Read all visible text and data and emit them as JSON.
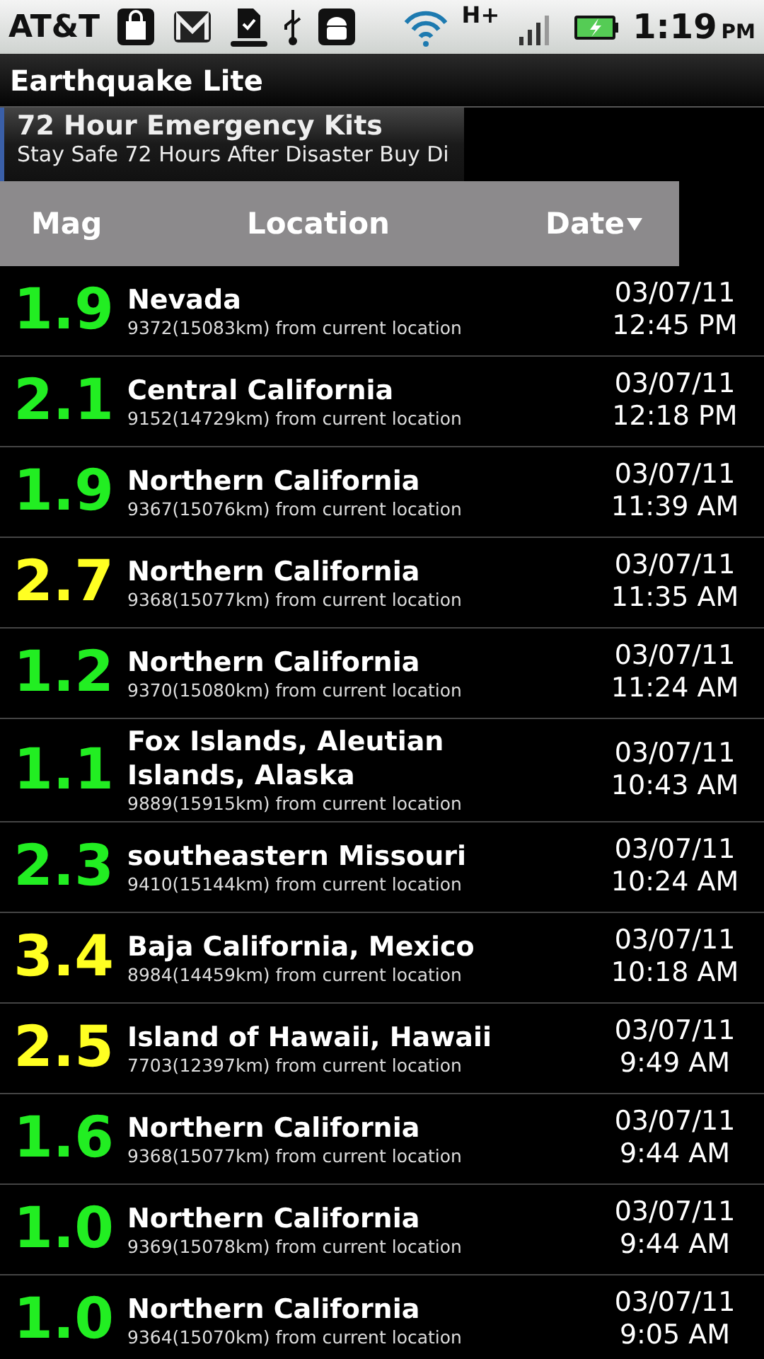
{
  "status_bar": {
    "carrier": "AT&T",
    "network": "H+",
    "time": "1:19",
    "period": "PM"
  },
  "app_title": "Earthquake Lite",
  "ad": {
    "title": "72 Hour Emergency Kits",
    "text": "Stay Safe 72 Hours After Disaster Buy Di"
  },
  "table": {
    "columns": [
      "Mag",
      "Location",
      "Date"
    ],
    "rows": [
      {
        "mag": "1.9",
        "color": "#22ee22",
        "location": "Nevada",
        "distance": "9372(15083km) from current location",
        "date": "03/07/11",
        "time": "12:45 PM"
      },
      {
        "mag": "2.1",
        "color": "#22ee22",
        "location": "Central California",
        "distance": "9152(14729km) from current location",
        "date": "03/07/11",
        "time": "12:18 PM"
      },
      {
        "mag": "1.9",
        "color": "#22ee22",
        "location": "Northern California",
        "distance": "9367(15076km) from current location",
        "date": "03/07/11",
        "time": "11:39 AM"
      },
      {
        "mag": "2.7",
        "color": "#ffff22",
        "location": "Northern California",
        "distance": "9368(15077km) from current location",
        "date": "03/07/11",
        "time": "11:35 AM"
      },
      {
        "mag": "1.2",
        "color": "#22ee22",
        "location": "Northern California",
        "distance": "9370(15080km) from current location",
        "date": "03/07/11",
        "time": "11:24 AM"
      },
      {
        "mag": "1.1",
        "color": "#22ee22",
        "location": "Fox Islands, Aleutian Islands, Alaska",
        "distance": "9889(15915km) from current location",
        "date": "03/07/11",
        "time": "10:43 AM"
      },
      {
        "mag": "2.3",
        "color": "#22ee22",
        "location": "southeastern Missouri",
        "distance": "9410(15144km) from current location",
        "date": "03/07/11",
        "time": "10:24 AM"
      },
      {
        "mag": "3.4",
        "color": "#ffff22",
        "location": "Baja California, Mexico",
        "distance": "8984(14459km) from current location",
        "date": "03/07/11",
        "time": "10:18 AM"
      },
      {
        "mag": "2.5",
        "color": "#ffff22",
        "location": "Island of Hawaii, Hawaii",
        "distance": "7703(12397km) from current location",
        "date": "03/07/11",
        "time": "9:49 AM"
      },
      {
        "mag": "1.6",
        "color": "#22ee22",
        "location": "Northern California",
        "distance": "9368(15077km) from current location",
        "date": "03/07/11",
        "time": "9:44 AM"
      },
      {
        "mag": "1.0",
        "color": "#22ee22",
        "location": "Northern California",
        "distance": "9369(15078km) from current location",
        "date": "03/07/11",
        "time": "9:44 AM"
      },
      {
        "mag": "1.0",
        "color": "#22ee22",
        "location": "Northern California",
        "distance": "9364(15070km) from current location",
        "date": "03/07/11",
        "time": "9:05 AM"
      }
    ]
  }
}
